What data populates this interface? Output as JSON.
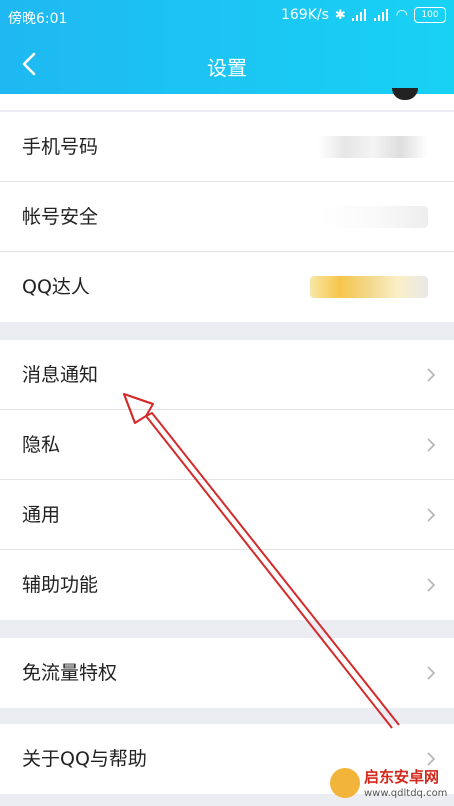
{
  "status": {
    "time": "傍晚6:01",
    "speed": "169K/s",
    "battery": "100"
  },
  "nav": {
    "title": "设置"
  },
  "section1": [
    {
      "label": "手机号码"
    },
    {
      "label": "帐号安全"
    },
    {
      "label": "QQ达人"
    }
  ],
  "section2": [
    {
      "label": "消息通知"
    },
    {
      "label": "隐私"
    },
    {
      "label": "通用"
    },
    {
      "label": "辅助功能"
    }
  ],
  "section3": [
    {
      "label": "免流量特权"
    }
  ],
  "section4": [
    {
      "label": "关于QQ与帮助"
    }
  ],
  "colors": {
    "header": "#1fb8f2",
    "annotation_arrow": "#d42a2a",
    "chevron": "#b8b8b8"
  },
  "watermark": {
    "name": "启东安卓网",
    "url": "www.qdltdq.com"
  }
}
